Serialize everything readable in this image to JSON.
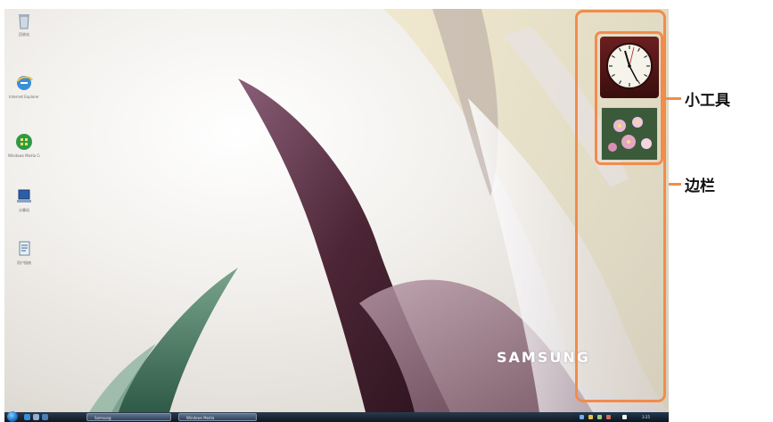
{
  "desktop": {
    "icons": [
      {
        "name": "recycle-bin",
        "label": "回收站"
      },
      {
        "name": "internet-explorer",
        "label": "Internet Explorer"
      },
      {
        "name": "windows-media-center",
        "label": "Windows Media Center"
      },
      {
        "name": "computer",
        "label": "计算机"
      },
      {
        "name": "user-guide",
        "label": "用户指南"
      }
    ],
    "brand": "SAMSUNG"
  },
  "taskbar": {
    "buttons": [
      "Samsung",
      "Windows Media"
    ],
    "tray_text": "3:25"
  },
  "annotations": {
    "gadgets": "小工具",
    "sidebar": "边栏"
  },
  "colors": {
    "highlight": "#f28c4b",
    "taskbar": "#1a2634"
  }
}
